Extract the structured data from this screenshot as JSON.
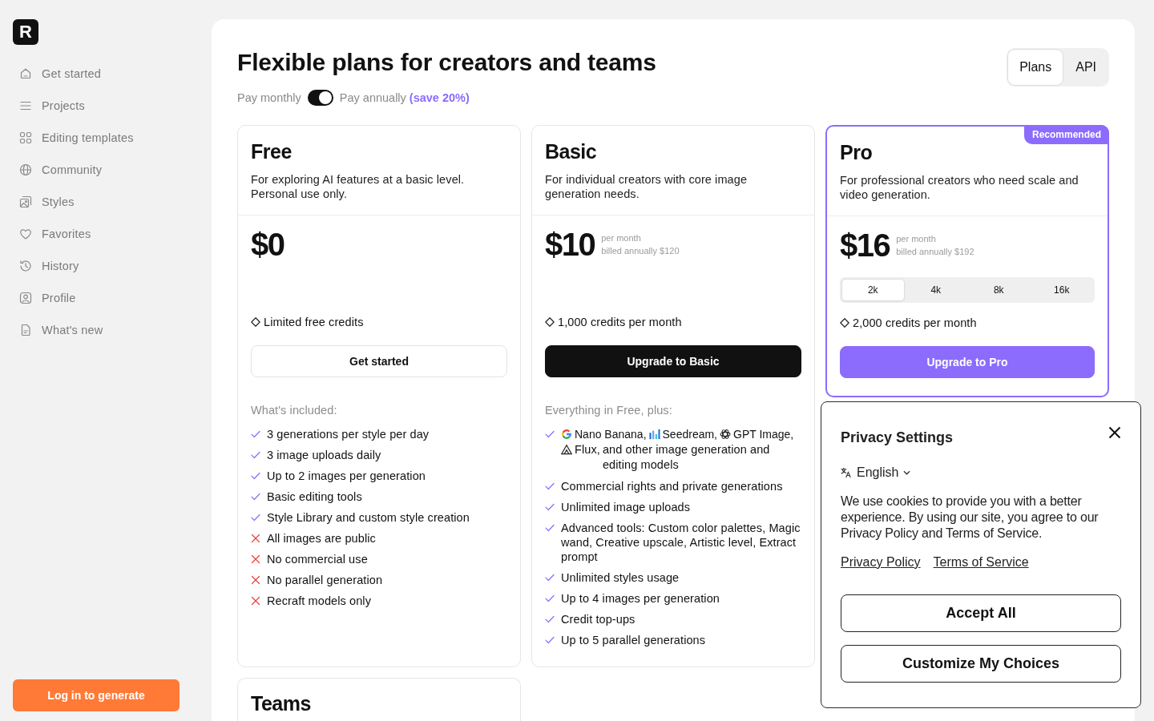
{
  "sidebar": {
    "logo": "R",
    "items": [
      "Get started",
      "Projects",
      "Editing templates",
      "Community",
      "Styles",
      "Favorites",
      "History",
      "Profile",
      "What's new"
    ],
    "login_button": "Log in to generate"
  },
  "header": {
    "title": "Flexible plans for creators and teams",
    "billing": {
      "monthly_label": "Pay monthly",
      "annual_label": "Pay annually",
      "save_note": "(save 20%)",
      "annual": true
    },
    "tabs": [
      {
        "label": "Plans",
        "selected": true
      },
      {
        "label": "API",
        "selected": false
      }
    ]
  },
  "plans": [
    {
      "name": "Free",
      "description": "For exploring AI features at a basic level. Personal use only.",
      "recommended": false,
      "price": "$0",
      "credits": "Limited free credits",
      "button": {
        "label": "Get started",
        "kind": "outline"
      },
      "features_heading": "What's included:",
      "features": [
        {
          "text": "3 generations per style per day",
          "included": true
        },
        {
          "text": "3 image uploads daily",
          "included": true
        },
        {
          "text": "Up to 2 images per generation",
          "included": true
        },
        {
          "text": "Basic editing tools",
          "included": true
        },
        {
          "text": "Style Library and custom style creation",
          "included": true
        },
        {
          "text": "All images are public",
          "included": false
        },
        {
          "text": "No commercial use",
          "included": false
        },
        {
          "text": "No parallel generation",
          "included": false
        },
        {
          "text": "Recraft models only",
          "included": false
        }
      ]
    },
    {
      "name": "Basic",
      "description": "For individual creators with core image generation needs.",
      "recommended": false,
      "price": "$10",
      "period": "per month",
      "billed": "billed annually $120",
      "credits": "1,000 credits per month",
      "button": {
        "label": "Upgrade to Basic",
        "kind": "dark"
      },
      "features_heading": "Everything in Free, plus:",
      "features": [
        {
          "models": [
            "Nano Banana,",
            "Seedream,",
            "GPT Image,",
            "Flux,"
          ],
          "text": "and other image generation and editing models",
          "included": true
        },
        {
          "text": "Commercial rights and private generations",
          "included": true
        },
        {
          "text": "Unlimited image uploads",
          "included": true
        },
        {
          "text": "Advanced tools: Custom color palettes, Magic wand, Creative upscale, Artistic level, Extract prompt",
          "included": true
        },
        {
          "text": "Unlimited styles usage",
          "included": true
        },
        {
          "text": "Up to 4 images per generation",
          "included": true
        },
        {
          "text": "Credit top-ups",
          "included": true
        },
        {
          "text": "Up to 5 parallel generations",
          "included": true
        }
      ]
    },
    {
      "name": "Pro",
      "badge": "Recommended",
      "description": "For professional creators who need scale and video generation.",
      "recommended": true,
      "price": "$16",
      "period": "per month",
      "billed": "billed annually $192",
      "tiers": [
        {
          "label": "2k",
          "selected": true
        },
        {
          "label": "4k",
          "selected": false
        },
        {
          "label": "8k",
          "selected": false
        },
        {
          "label": "16k",
          "selected": false
        }
      ],
      "credits": "2,000 credits per month",
      "button": {
        "label": "Upgrade to Pro",
        "kind": "accent"
      }
    }
  ],
  "more_plans": [
    {
      "name": "Teams"
    }
  ],
  "privacy_dialog": {
    "title": "Privacy Settings",
    "language": "English",
    "text": "We use cookies to provide you with a better experience. By using our site, you agree to our Privacy Policy and Terms of Service.",
    "links": [
      "Privacy Policy",
      "Terms of Service"
    ],
    "buttons": [
      "Accept All",
      "Customize My Choices"
    ]
  }
}
